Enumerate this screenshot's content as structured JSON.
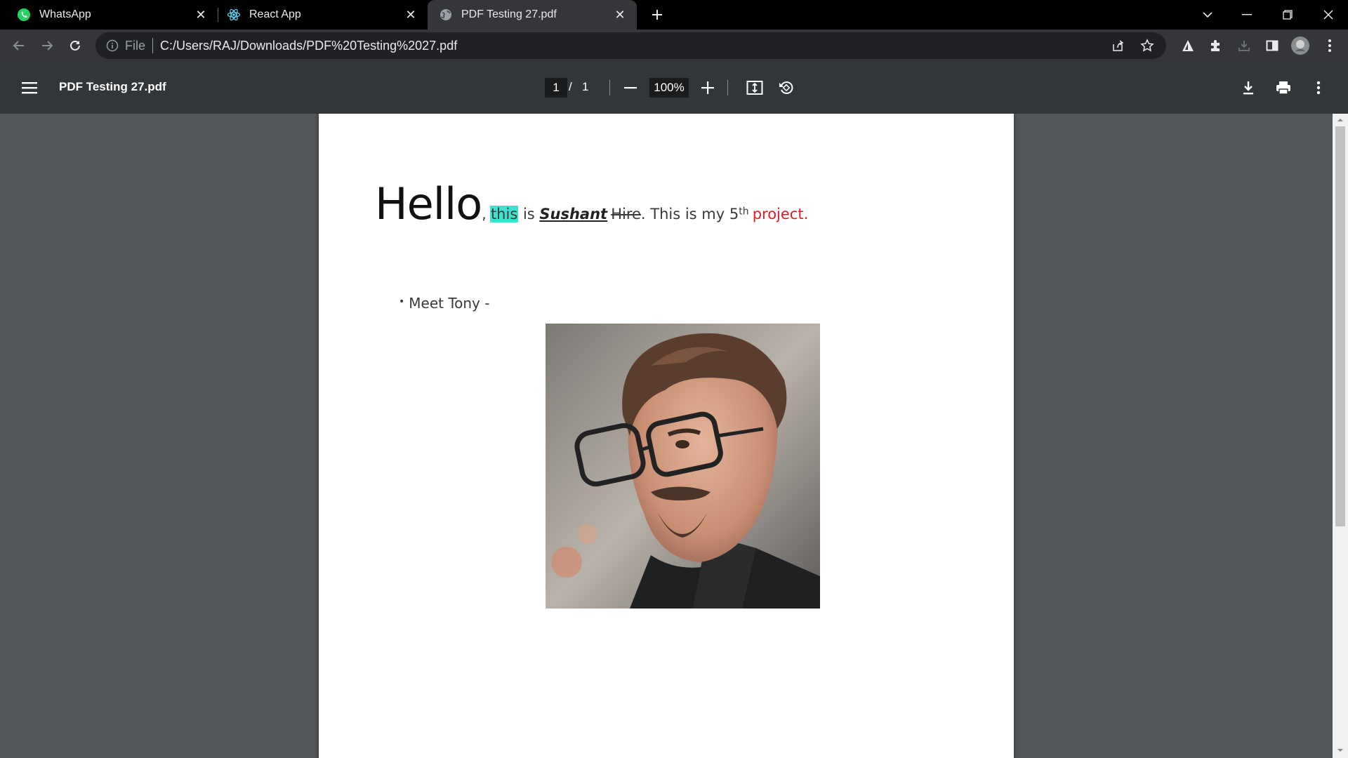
{
  "tabs": [
    {
      "title": "WhatsApp",
      "icon": "whatsapp-icon",
      "active": false
    },
    {
      "title": "React App",
      "icon": "react-icon",
      "active": false
    },
    {
      "title": "PDF Testing 27.pdf",
      "icon": "globe-icon",
      "active": true
    }
  ],
  "address_bar": {
    "scheme_label": "File",
    "url": "C:/Users/RAJ/Downloads/PDF%20Testing%2027.pdf"
  },
  "pdf_toolbar": {
    "title": "PDF Testing 27.pdf",
    "current_page": "1",
    "page_separator": "/",
    "total_pages": "1",
    "zoom": "100%"
  },
  "document": {
    "hello": "Hello",
    "comma": ",",
    "highlighted": "this",
    "is": " is ",
    "name": "Sushant",
    "struck": "Hire",
    "sentence": ". This is my 5",
    "superscript": "th",
    "colored": "project.",
    "bullet_text": "Meet Tony -",
    "bullet_glyph": "•"
  },
  "colors": {
    "highlight": "#40e0d0",
    "red_text": "#e51c23",
    "whatsapp": "#25d366",
    "react": "#61dafb"
  }
}
